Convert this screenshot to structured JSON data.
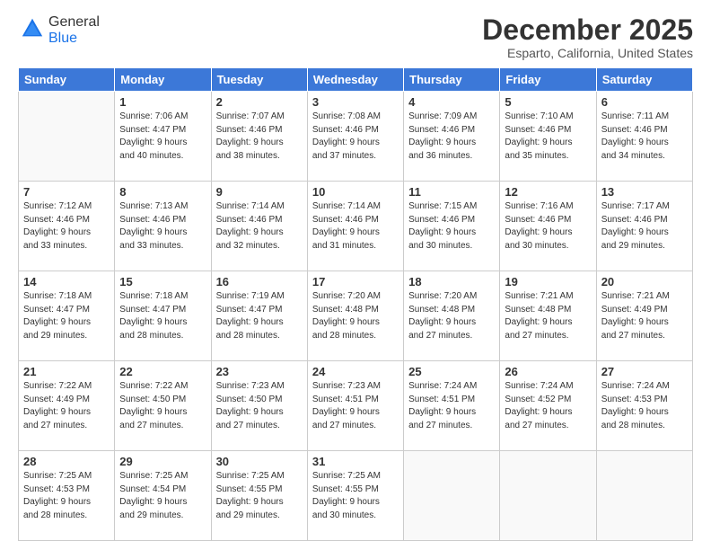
{
  "header": {
    "logo_general": "General",
    "logo_blue": "Blue",
    "title": "December 2025",
    "subtitle": "Esparto, California, United States"
  },
  "weekdays": [
    "Sunday",
    "Monday",
    "Tuesday",
    "Wednesday",
    "Thursday",
    "Friday",
    "Saturday"
  ],
  "weeks": [
    [
      {
        "day": "",
        "info": ""
      },
      {
        "day": "1",
        "info": "Sunrise: 7:06 AM\nSunset: 4:47 PM\nDaylight: 9 hours\nand 40 minutes."
      },
      {
        "day": "2",
        "info": "Sunrise: 7:07 AM\nSunset: 4:46 PM\nDaylight: 9 hours\nand 38 minutes."
      },
      {
        "day": "3",
        "info": "Sunrise: 7:08 AM\nSunset: 4:46 PM\nDaylight: 9 hours\nand 37 minutes."
      },
      {
        "day": "4",
        "info": "Sunrise: 7:09 AM\nSunset: 4:46 PM\nDaylight: 9 hours\nand 36 minutes."
      },
      {
        "day": "5",
        "info": "Sunrise: 7:10 AM\nSunset: 4:46 PM\nDaylight: 9 hours\nand 35 minutes."
      },
      {
        "day": "6",
        "info": "Sunrise: 7:11 AM\nSunset: 4:46 PM\nDaylight: 9 hours\nand 34 minutes."
      }
    ],
    [
      {
        "day": "7",
        "info": "Sunrise: 7:12 AM\nSunset: 4:46 PM\nDaylight: 9 hours\nand 33 minutes."
      },
      {
        "day": "8",
        "info": "Sunrise: 7:13 AM\nSunset: 4:46 PM\nDaylight: 9 hours\nand 33 minutes."
      },
      {
        "day": "9",
        "info": "Sunrise: 7:14 AM\nSunset: 4:46 PM\nDaylight: 9 hours\nand 32 minutes."
      },
      {
        "day": "10",
        "info": "Sunrise: 7:14 AM\nSunset: 4:46 PM\nDaylight: 9 hours\nand 31 minutes."
      },
      {
        "day": "11",
        "info": "Sunrise: 7:15 AM\nSunset: 4:46 PM\nDaylight: 9 hours\nand 30 minutes."
      },
      {
        "day": "12",
        "info": "Sunrise: 7:16 AM\nSunset: 4:46 PM\nDaylight: 9 hours\nand 30 minutes."
      },
      {
        "day": "13",
        "info": "Sunrise: 7:17 AM\nSunset: 4:46 PM\nDaylight: 9 hours\nand 29 minutes."
      }
    ],
    [
      {
        "day": "14",
        "info": "Sunrise: 7:18 AM\nSunset: 4:47 PM\nDaylight: 9 hours\nand 29 minutes."
      },
      {
        "day": "15",
        "info": "Sunrise: 7:18 AM\nSunset: 4:47 PM\nDaylight: 9 hours\nand 28 minutes."
      },
      {
        "day": "16",
        "info": "Sunrise: 7:19 AM\nSunset: 4:47 PM\nDaylight: 9 hours\nand 28 minutes."
      },
      {
        "day": "17",
        "info": "Sunrise: 7:20 AM\nSunset: 4:48 PM\nDaylight: 9 hours\nand 28 minutes."
      },
      {
        "day": "18",
        "info": "Sunrise: 7:20 AM\nSunset: 4:48 PM\nDaylight: 9 hours\nand 27 minutes."
      },
      {
        "day": "19",
        "info": "Sunrise: 7:21 AM\nSunset: 4:48 PM\nDaylight: 9 hours\nand 27 minutes."
      },
      {
        "day": "20",
        "info": "Sunrise: 7:21 AM\nSunset: 4:49 PM\nDaylight: 9 hours\nand 27 minutes."
      }
    ],
    [
      {
        "day": "21",
        "info": "Sunrise: 7:22 AM\nSunset: 4:49 PM\nDaylight: 9 hours\nand 27 minutes."
      },
      {
        "day": "22",
        "info": "Sunrise: 7:22 AM\nSunset: 4:50 PM\nDaylight: 9 hours\nand 27 minutes."
      },
      {
        "day": "23",
        "info": "Sunrise: 7:23 AM\nSunset: 4:50 PM\nDaylight: 9 hours\nand 27 minutes."
      },
      {
        "day": "24",
        "info": "Sunrise: 7:23 AM\nSunset: 4:51 PM\nDaylight: 9 hours\nand 27 minutes."
      },
      {
        "day": "25",
        "info": "Sunrise: 7:24 AM\nSunset: 4:51 PM\nDaylight: 9 hours\nand 27 minutes."
      },
      {
        "day": "26",
        "info": "Sunrise: 7:24 AM\nSunset: 4:52 PM\nDaylight: 9 hours\nand 27 minutes."
      },
      {
        "day": "27",
        "info": "Sunrise: 7:24 AM\nSunset: 4:53 PM\nDaylight: 9 hours\nand 28 minutes."
      }
    ],
    [
      {
        "day": "28",
        "info": "Sunrise: 7:25 AM\nSunset: 4:53 PM\nDaylight: 9 hours\nand 28 minutes."
      },
      {
        "day": "29",
        "info": "Sunrise: 7:25 AM\nSunset: 4:54 PM\nDaylight: 9 hours\nand 29 minutes."
      },
      {
        "day": "30",
        "info": "Sunrise: 7:25 AM\nSunset: 4:55 PM\nDaylight: 9 hours\nand 29 minutes."
      },
      {
        "day": "31",
        "info": "Sunrise: 7:25 AM\nSunset: 4:55 PM\nDaylight: 9 hours\nand 30 minutes."
      },
      {
        "day": "",
        "info": ""
      },
      {
        "day": "",
        "info": ""
      },
      {
        "day": "",
        "info": ""
      }
    ]
  ]
}
